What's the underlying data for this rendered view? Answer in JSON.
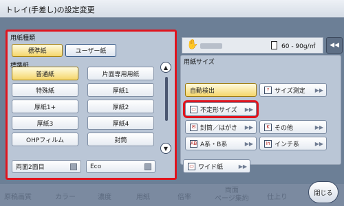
{
  "window": {
    "title": "トレイ(手差し)の設定変更"
  },
  "left": {
    "type_section_label": "用紙種類",
    "type_buttons": [
      {
        "label": "標準紙",
        "selected": true
      },
      {
        "label": "ユーザー紙",
        "selected": false
      }
    ],
    "category_label": "標準紙",
    "paper_buttons": [
      {
        "label": "普通紙",
        "selected": true
      },
      {
        "label": "片面専用用紙",
        "selected": false
      },
      {
        "label": "特殊紙",
        "selected": false
      },
      {
        "label": "厚紙1",
        "selected": false
      },
      {
        "label": "厚紙1+",
        "selected": false
      },
      {
        "label": "厚紙2",
        "selected": false
      },
      {
        "label": "厚紙3",
        "selected": false
      },
      {
        "label": "厚紙4",
        "selected": false
      },
      {
        "label": "OHPフィルム",
        "selected": false
      },
      {
        "label": "封筒",
        "selected": false
      }
    ],
    "duplex_2nd_label": "両面2面目",
    "eco_label": "Eco"
  },
  "right": {
    "weight_text": "60 - 90g/㎡",
    "size_section_label": "用紙サイズ",
    "auto_detect_label": "自動検出",
    "size_measure_label": "サイズ測定",
    "custom_size_label": "不定形サイズ",
    "envelope_label": "封筒／はがき",
    "other_label": "その他",
    "a_b_series_label": "A系・B系",
    "inch_series_label": "インチ系",
    "wide_paper_label": "ワイド紙"
  },
  "footer": {
    "close_label": "閉じる",
    "ghost_tabs": [
      "原稿画質",
      "カラー",
      "濃度",
      "用紙",
      "倍率",
      "両面\nページ集約",
      "仕上り"
    ]
  },
  "colors": {
    "highlight_red": "#e0141e",
    "selected_yellow": "#f5d66a",
    "panel_blue": "#bac6d6"
  }
}
